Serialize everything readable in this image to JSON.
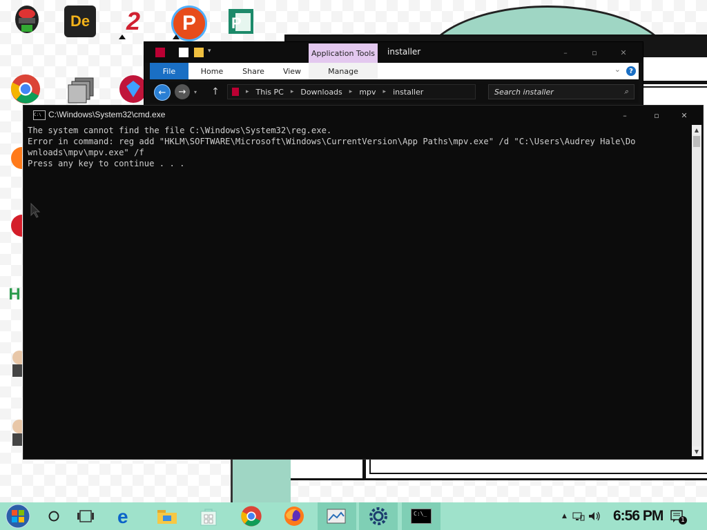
{
  "explorer": {
    "app_tools_label": "Application Tools",
    "title": "installer",
    "tabs": [
      "File",
      "Home",
      "Share",
      "View",
      "Manage"
    ],
    "breadcrumb": [
      "This PC",
      "Downloads",
      "mpv",
      "installer"
    ],
    "search_placeholder": "Search installer",
    "help_symbol": "?"
  },
  "cmd": {
    "title": "C:\\Windows\\System32\\cmd.exe",
    "icon_text": "C:\\",
    "lines": [
      "The system cannot find the file C:\\Windows\\System32\\reg.exe.",
      "Error in command: reg add \"HKLM\\SOFTWARE\\Microsoft\\Windows\\CurrentVersion\\App Paths\\mpv.exe\" /d \"C:\\Users\\Audrey Hale\\Do",
      "wnloads\\mpv\\mpv.exe\" /f",
      "Press any key to continue . . ."
    ]
  },
  "desktop": {
    "icon_letters": {
      "de": "De",
      "two": "2",
      "p": "P"
    }
  },
  "taskbar": {
    "time": "6:56 PM",
    "notification_count": "1",
    "terminal_icon_text": "C:\\_"
  },
  "colors": {
    "taskbar": "#9fe2cb",
    "accent_blue": "#1a6fc4",
    "app_tools": "#e3c8ef",
    "console_bg": "#0c0c0c",
    "console_text": "#cfcfcf"
  }
}
